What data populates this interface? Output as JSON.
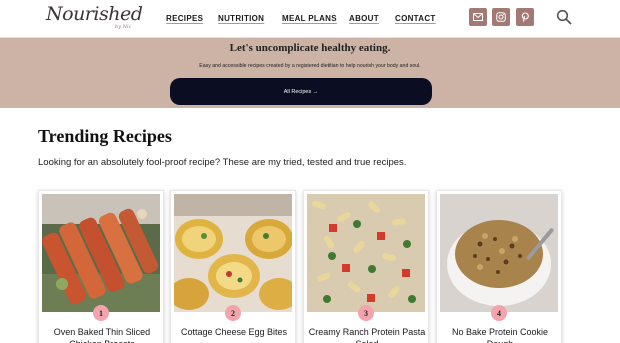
{
  "brand": {
    "logo_main": "Nourished",
    "logo_sub": "by Nic"
  },
  "nav": {
    "items": [
      "RECIPES",
      "NUTRITION",
      "MEAL PLANS",
      "ABOUT",
      "CONTACT"
    ]
  },
  "social": {
    "icons": [
      "mail-icon",
      "instagram-icon",
      "pinterest-icon"
    ],
    "color": "#a37a73"
  },
  "search": {
    "icon": "search-icon"
  },
  "hero": {
    "title": "Let's uncomplicate healthy eating.",
    "subtitle": "Easy and accessible recipes created by a registered dietitian to help nourish your body and soul.",
    "button_label": "All Recipes →",
    "background": "#ccb3a5",
    "button_color": "#0b0d22"
  },
  "trending": {
    "title": "Trending Recipes",
    "description": "Looking for an absolutely fool-proof recipe? These are my tried, tested and true recipes.",
    "badge_color": "#f2a4ac",
    "cards": [
      {
        "rank": "1",
        "title": "Oven Baked Thin Sliced Chicken Breasts"
      },
      {
        "rank": "2",
        "title": "Cottage Cheese Egg Bites"
      },
      {
        "rank": "3",
        "title": "Creamy Ranch Protein Pasta Salad"
      },
      {
        "rank": "4",
        "title": "No Bake Protein Cookie Dough"
      }
    ]
  }
}
